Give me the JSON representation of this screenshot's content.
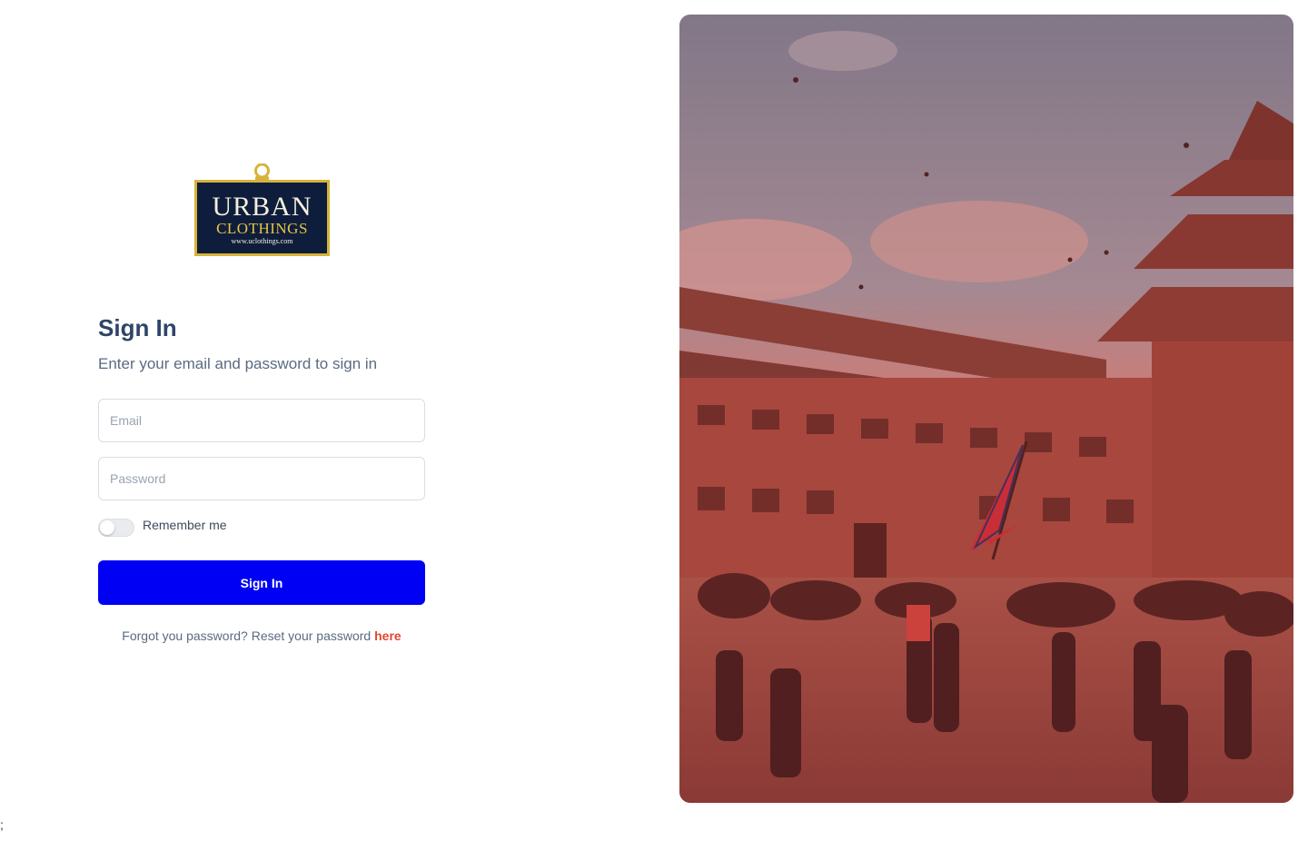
{
  "logo": {
    "line1": "URBAN",
    "line2": "CLOTHINGS",
    "line3": "www.uclothings.com",
    "colors": {
      "plate": "#0f1d3d",
      "frame": "#d6b33a"
    }
  },
  "signin": {
    "title": "Sign In",
    "subtitle": "Enter your email and password to sign in",
    "email_placeholder": "Email",
    "password_placeholder": "Password",
    "remember_label": "Remember me",
    "button_label": "Sign In",
    "forgot_text": "Forgot you password? Reset your password",
    "forgot_link": "here"
  },
  "hero_image": {
    "overlay_color": "#b43a3a",
    "description_icon": "temple-square-photo"
  },
  "stray_text": ";",
  "colors": {
    "primary": "#0000f5",
    "link": "#e0482f",
    "heading": "#2f4567"
  }
}
